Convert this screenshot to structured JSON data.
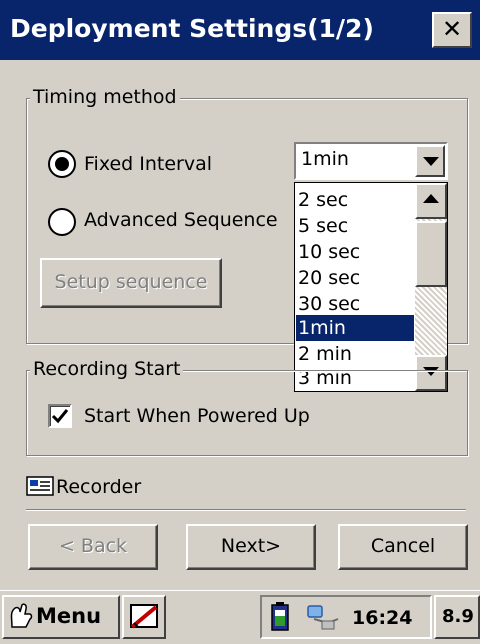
{
  "window": {
    "title": "Deployment Settings(1/2)",
    "close_glyph": "✕"
  },
  "timing": {
    "group_label": "Timing method",
    "fixed_label": "Fixed Interval",
    "advanced_label": "Advanced Sequence",
    "setup_button": "Setup sequence",
    "selected_mode": "fixed",
    "interval_value": "1min",
    "options": [
      "2 sec",
      "5 sec",
      "10 sec",
      "20 sec",
      "30 sec",
      "1min",
      "2 min",
      "3 min"
    ],
    "selected_option": "1min"
  },
  "recording": {
    "group_label": "Recording Start",
    "start_powered_label": "Start When Powered Up",
    "start_powered_checked": true
  },
  "recorder_label": "Recorder",
  "nav": {
    "back": "< Back",
    "next": "Next>",
    "cancel": "Cancel"
  },
  "taskbar": {
    "menu": "Menu",
    "clock": "16:24",
    "input_indicator": "8.9"
  },
  "colors": {
    "title_bar": "#08246b",
    "face": "#d4d0c8",
    "highlight": "#08246b"
  },
  "icons": [
    "close-icon",
    "chevron-down-icon",
    "chevron-up-icon",
    "checkmark-icon",
    "recorder-icon",
    "start-menu-icon",
    "pen-tool-icon",
    "battery-icon",
    "connection-icon"
  ]
}
